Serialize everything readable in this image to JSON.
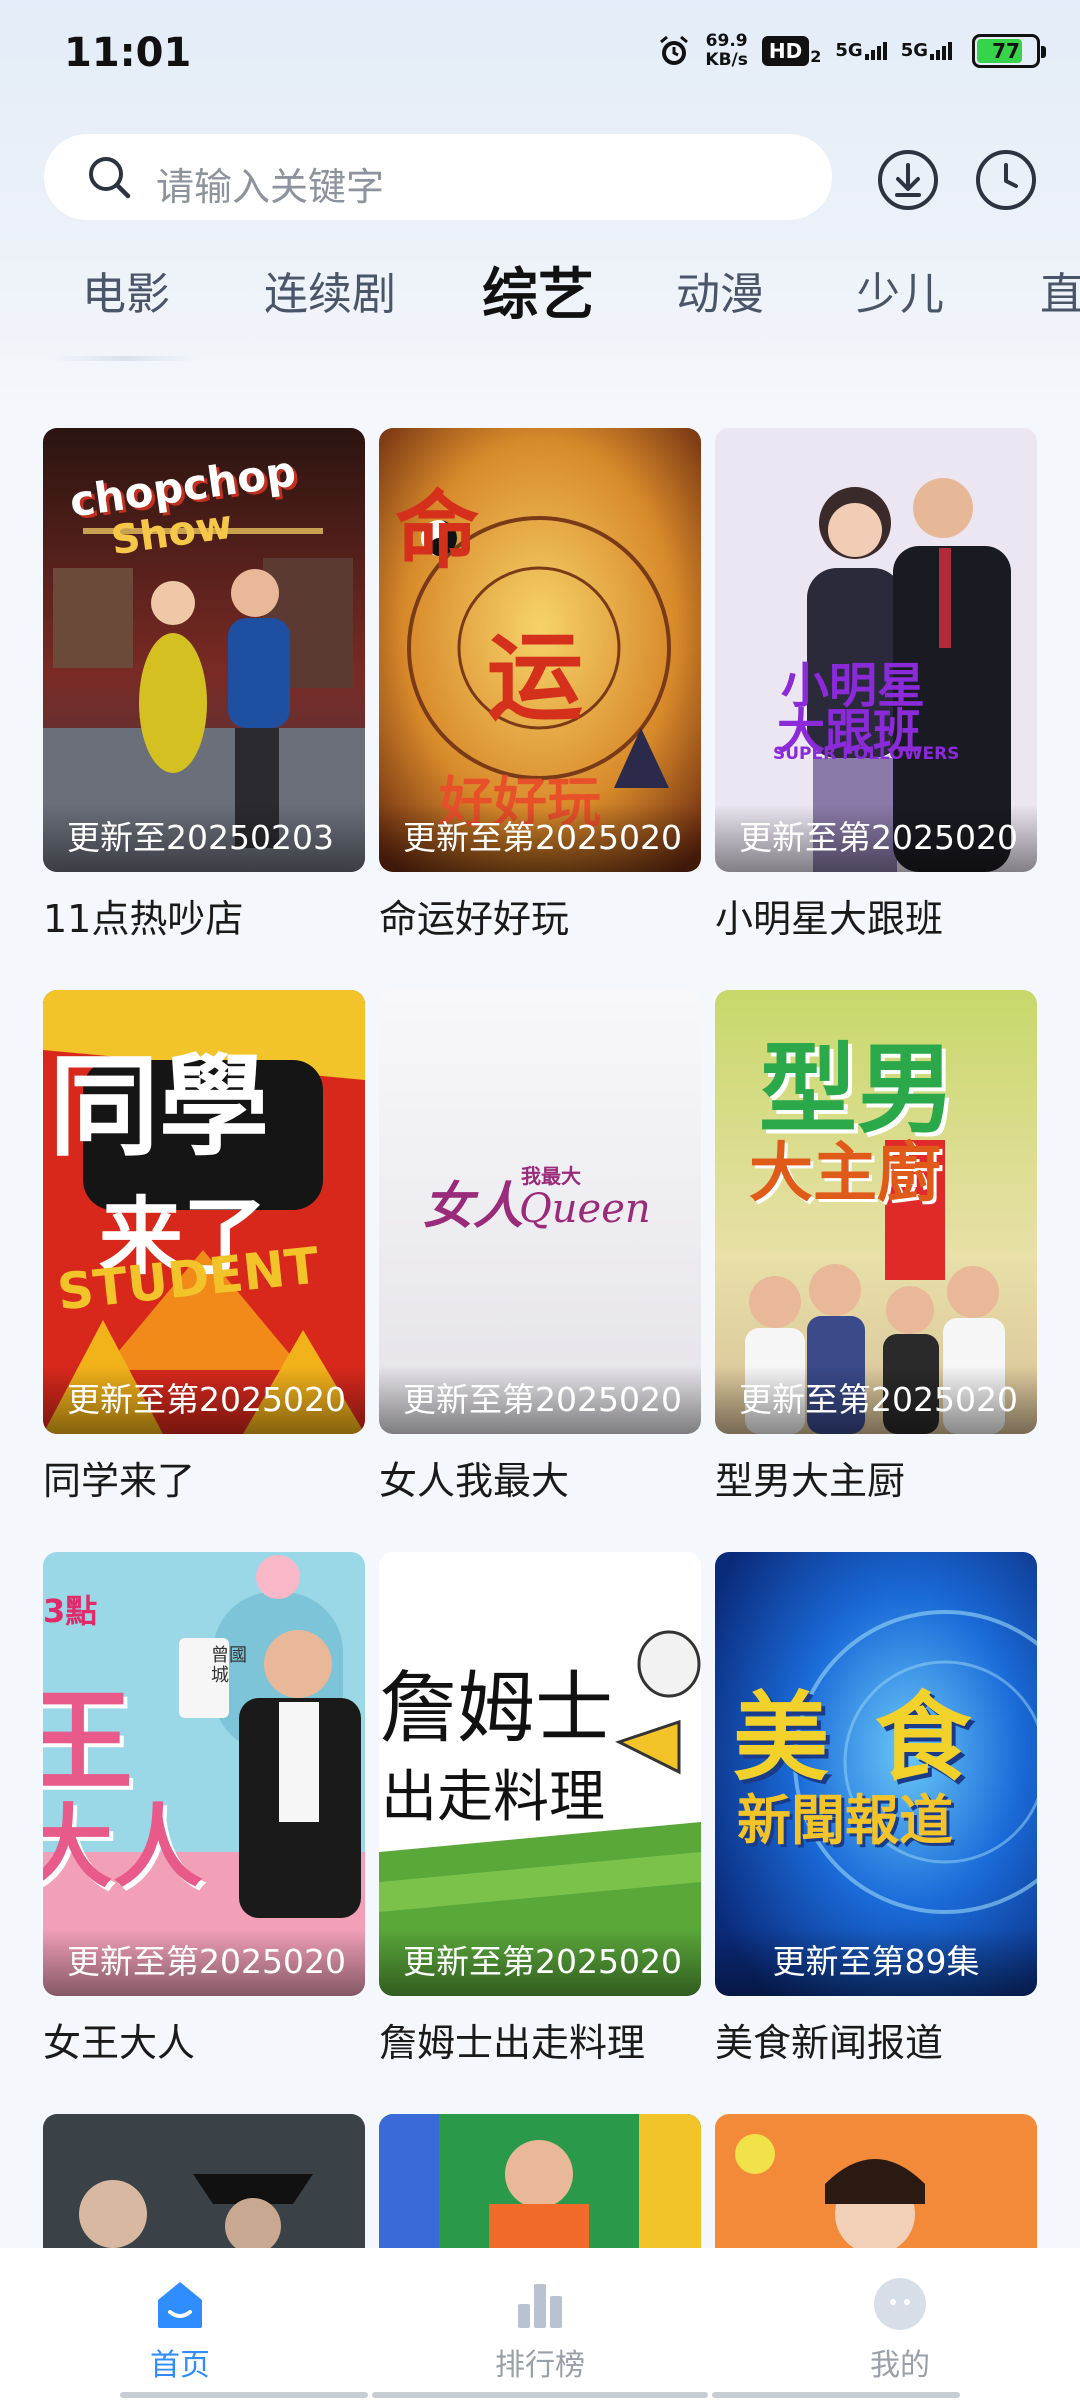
{
  "status_bar": {
    "time": "11:01",
    "net_speed_value": "69.9",
    "net_speed_unit": "KB/s",
    "hd_label": "HD",
    "hd_sub": "2",
    "signal_1": "5G",
    "signal_2": "5G",
    "battery_level": "77",
    "icons": [
      "alarm-icon",
      "hd-icon",
      "signal-icon",
      "battery-icon"
    ]
  },
  "search": {
    "placeholder": "请输入关键字"
  },
  "header_actions": [
    "download-icon",
    "history-icon"
  ],
  "categories": [
    "电影",
    "连续剧",
    "综艺",
    "动漫",
    "少儿",
    "直"
  ],
  "active_category": "综艺",
  "items": [
    {
      "title": "11点热吵店",
      "update": "更新至20250203"
    },
    {
      "title": "命运好好玩",
      "update": "更新至第2025020"
    },
    {
      "title": "小明星大跟班",
      "update": "更新至第2025020"
    },
    {
      "title": "同学来了",
      "update": "更新至第2025020"
    },
    {
      "title": "女人我最大",
      "update": "更新至第2025020"
    },
    {
      "title": "型男大主厨",
      "update": "更新至第2025020"
    },
    {
      "title": "女王大人",
      "update": "更新至第2025020"
    },
    {
      "title": "詹姆士出走料理",
      "update": "更新至第2025020"
    },
    {
      "title": "美食新闻报道",
      "update": "更新至第89集"
    }
  ],
  "poster_text": {
    "p1_a": "chopchop",
    "p1_b": "Show",
    "p2_a": "命",
    "p2_b": "运",
    "p2_c": "好好玩",
    "p3_a": "小明星",
    "p3_b": "大跟班",
    "p3_c": "SUPER FOLLOWERS",
    "p4_a": "同學",
    "p4_b": "来了",
    "p4_c": "STUDENT",
    "p5_a": "女人",
    "p5_b": "我最大",
    "p5_c": "Queen",
    "p6_a": "型男",
    "p6_b": "大主廚",
    "p7_a": "3點",
    "p7_b": "王",
    "p7_c": "大人",
    "p7_d": "曾國城",
    "p8_a": "詹姆士",
    "p8_b": "出走料理",
    "p9_a": "美",
    "p9_b": "食",
    "p9_c": "新聞報道"
  },
  "bottom_nav": [
    {
      "label": "首页",
      "icon": "home-icon",
      "active": true
    },
    {
      "label": "排行榜",
      "icon": "ranking-icon",
      "active": false
    },
    {
      "label": "我的",
      "icon": "profile-icon",
      "active": false
    }
  ],
  "colors": {
    "accent": "#2f8dff",
    "inactive_nav": "#9aa0a8"
  }
}
